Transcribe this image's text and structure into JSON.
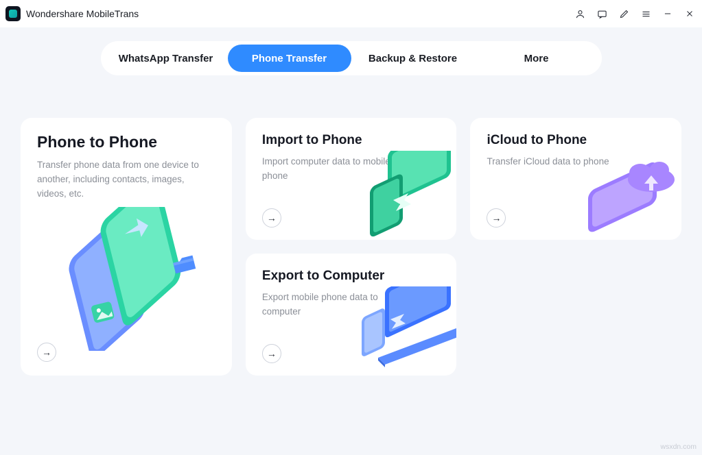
{
  "app": {
    "title": "Wondershare MobileTrans"
  },
  "tabs": {
    "whatsapp": "WhatsApp Transfer",
    "phone": "Phone Transfer",
    "backup": "Backup & Restore",
    "more": "More"
  },
  "cards": {
    "p2p": {
      "title": "Phone to Phone",
      "desc": "Transfer phone data from one device to another, including contacts, images, videos, etc."
    },
    "import": {
      "title": "Import to Phone",
      "desc": "Import computer data to mobile phone"
    },
    "export": {
      "title": "Export to Computer",
      "desc": "Export mobile phone data to computer"
    },
    "icloud": {
      "title": "iCloud to Phone",
      "desc": "Transfer iCloud data to phone"
    }
  },
  "watermark": "wsxdn.com"
}
